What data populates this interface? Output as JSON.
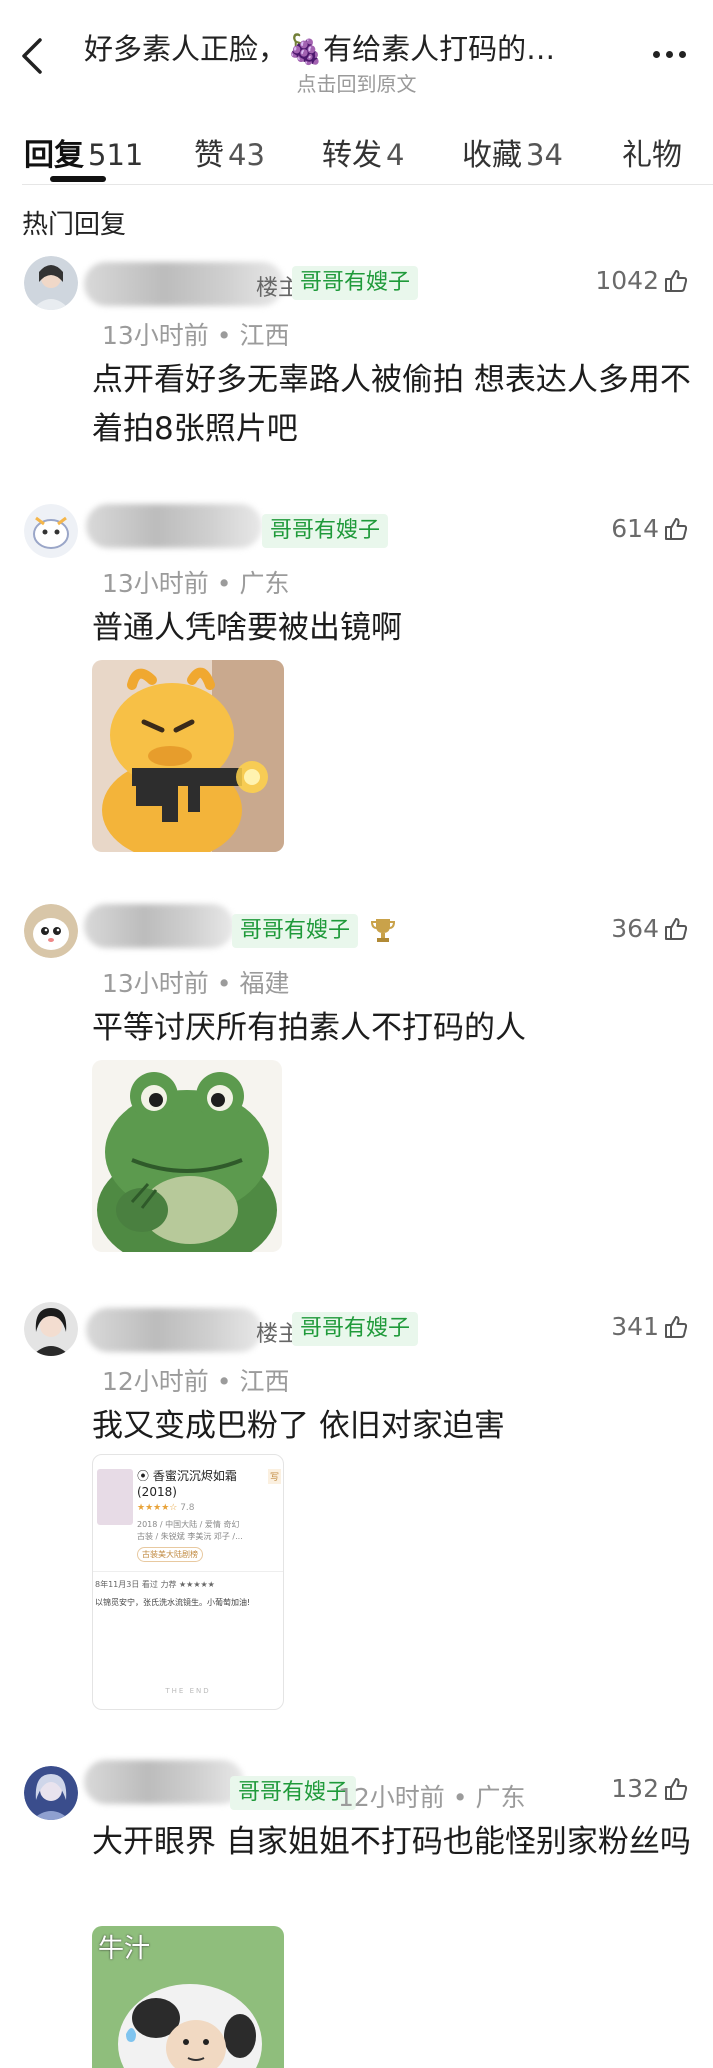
{
  "header": {
    "title": "好多素人正脸，🍇有给素人打码的…",
    "subtitle": "点击回到原文"
  },
  "tabs": [
    {
      "label": "回复",
      "count": "511"
    },
    {
      "label": "赞",
      "count": "43"
    },
    {
      "label": "转发",
      "count": "4"
    },
    {
      "label": "收藏",
      "count": "34"
    },
    {
      "label": "礼物",
      "count": ""
    }
  ],
  "section_title": "热门回复",
  "comments": [
    {
      "name_tail": "楼主",
      "badge": "哥哥有嫂子",
      "meta": "13小时前 • 江西",
      "likes": "1042",
      "text": "点开看好多无辜路人被偷拍 想表达人多用不着拍8张照片吧"
    },
    {
      "name_tail": "",
      "badge": "哥哥有嫂子",
      "meta": "13小时前 • 广东",
      "likes": "614",
      "text": "普通人凭啥要被出镜啊"
    },
    {
      "name_tail": "",
      "badge": "哥哥有嫂子",
      "meta": "13小时前 • 福建",
      "likes": "364",
      "text": "平等讨厌所有拍素人不打码的人"
    },
    {
      "name_tail": "楼主",
      "badge": "哥哥有嫂子",
      "meta": "12小时前 • 江西",
      "likes": "341",
      "text": "我又变成巴粉了 依旧对家迫害"
    },
    {
      "name_tail": "",
      "badge": "哥哥有嫂子",
      "meta": "12小时前 • 广东",
      "likes": "132",
      "text": "大开眼界 自家姐姐不打码也能怪别家粉丝吗"
    }
  ],
  "card": {
    "title": "香蜜沉沉烬如霜",
    "year": "(2018)",
    "rating": "7.8",
    "info": "2018 / 中国大陆 / 爱情 奇幻",
    "cast": "古装 / 朱锐斌 李美沅 邓子 /...",
    "button": "古装美大陆剧榜",
    "date_line": "8年11月3日 看过  力荐 ★★★★★",
    "review": "以锦觅安宁，张氏洗水流镜生。小葡萄加油!",
    "end": "THE END",
    "side": "写"
  },
  "sticker_caption": "牛汁",
  "colors": {
    "badge_text": "#1f9a3a",
    "badge_bg": "#e9f7ec",
    "meta": "#9b9b9b"
  }
}
